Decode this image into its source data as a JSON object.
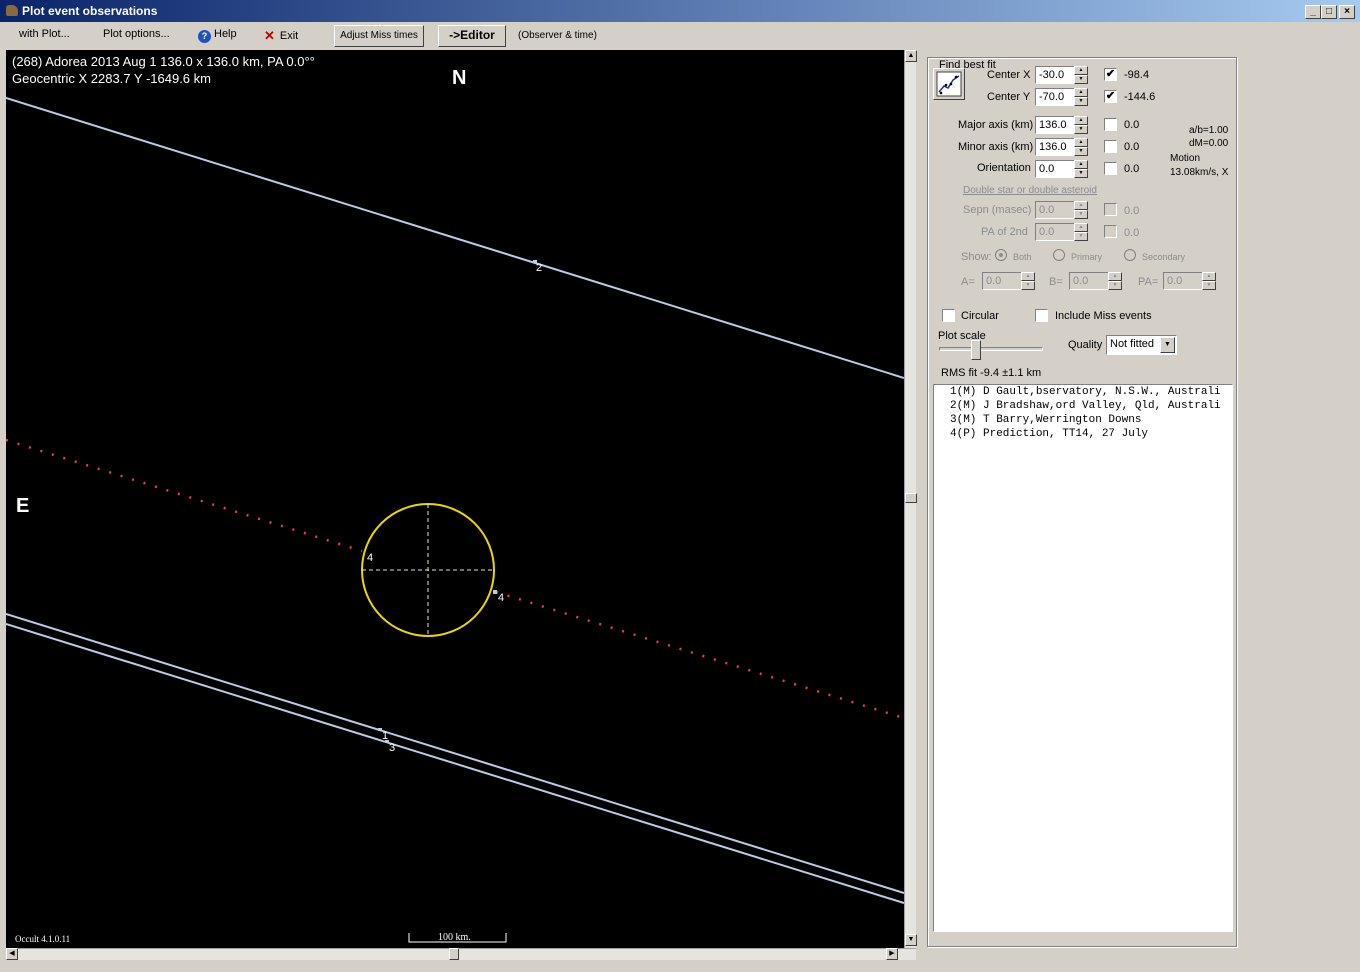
{
  "window": {
    "title": "Plot event observations"
  },
  "menu": {
    "with_plot": "with Plot...",
    "plot_options": "Plot options...",
    "help": "Help",
    "exit": "Exit",
    "adjust_miss": "Adjust Miss times",
    "editor": "->Editor",
    "observer_time": "(Observer & time)"
  },
  "plot": {
    "header_line1": "(268) Adorea  2013 Aug 1   136.0 x 136.0 km, PA 0.0°°",
    "header_line2": "Geocentric X  2283.7  Y -1649.6 km",
    "north": "N",
    "east": "E",
    "version": "Occult 4.1.0.11",
    "scale_label": "100 km.",
    "chord_labels": {
      "c2": "2",
      "c4a": "4",
      "c4b": "4",
      "c1": "1",
      "c3": "3"
    }
  },
  "fit": {
    "group_title": "Find best fit",
    "center_x": {
      "label": "Center X",
      "value": "-30.0",
      "checked": "✔",
      "result": "-98.4"
    },
    "center_y": {
      "label": "Center Y",
      "value": "-70.0",
      "checked": "✔",
      "result": "-144.6"
    },
    "major": {
      "label": "Major axis (km)",
      "value": "136.0",
      "result": "0.0"
    },
    "minor": {
      "label": "Minor axis (km)",
      "value": "136.0",
      "result": "0.0"
    },
    "orient": {
      "label": "Orientation",
      "value": "0.0",
      "result": "0.0"
    },
    "ab": "a/b=1.00",
    "dm": "dM=0.00",
    "motion_label": "Motion",
    "motion_value": "13.08km/s, X",
    "double_label": "Double star  or  double asteroid",
    "sepn": {
      "label": "Sepn (masec)",
      "value": "0.0",
      "result": "0.0"
    },
    "pa2": {
      "label": "PA of 2nd",
      "value": "0.0",
      "result": "0.0"
    },
    "show_label": "Show:",
    "show_both": "Both",
    "show_primary": "Primary",
    "show_secondary": "Secondary",
    "a_label": "A=",
    "a_value": "0.0",
    "b_label": "B=",
    "b_value": "0.0",
    "pa_label": "PA=",
    "pa_value": "0.0",
    "circular": "Circular",
    "include_miss": "Include Miss events",
    "plot_scale": "Plot scale",
    "quality_label": "Quality",
    "quality_value": "Not fitted",
    "rms": "RMS fit -9.4 ±1.1 km"
  },
  "observers": [
    "1(M) D Gault,bservatory, N.S.W., Australi",
    "2(M) J Bradshaw,ord Valley, Qld, Australi",
    "3(M) T Barry,Werrington Downs",
    "4(P) Prediction, TT14, 27 July"
  ]
}
